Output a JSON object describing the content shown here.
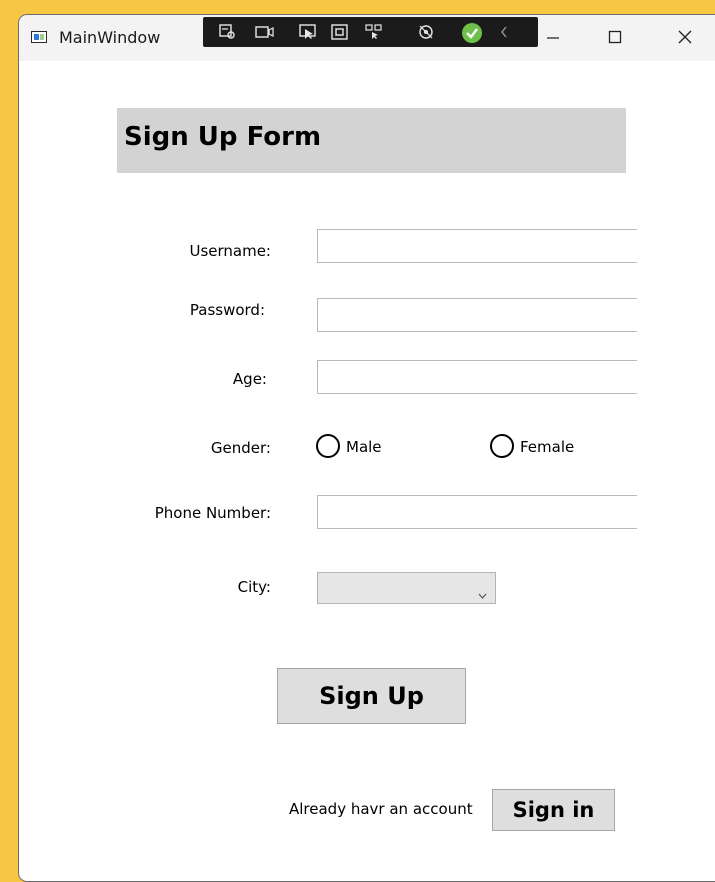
{
  "window": {
    "title": "MainWindow",
    "controls": {
      "minimize": "—",
      "maximize": "□",
      "close": "✕"
    }
  },
  "debug_toolbar": {
    "icons": [
      "select-element-icon",
      "video-record-icon",
      "pointer-select-icon",
      "frame-icon",
      "display-layout-icon",
      "hot-reload-icon",
      "check-icon",
      "collapse-arrow-icon"
    ]
  },
  "form": {
    "title": "Sign Up Form",
    "fields": {
      "username": {
        "label": "Username:",
        "value": ""
      },
      "password": {
        "label": "Password:",
        "value": ""
      },
      "age": {
        "label": "Age:",
        "value": ""
      },
      "phone": {
        "label": "Phone  Number:",
        "value": ""
      }
    },
    "gender": {
      "label": "Gender:",
      "options": [
        "Male",
        "Female"
      ]
    },
    "city": {
      "label": "City:",
      "value": ""
    },
    "signup_button": "Sign Up",
    "signin_hint": "Already havr an account",
    "signin_button": "Sign in"
  },
  "colors": {
    "background": "#f7c744",
    "header_band": "#d3d3d3",
    "button": "#dedede"
  }
}
